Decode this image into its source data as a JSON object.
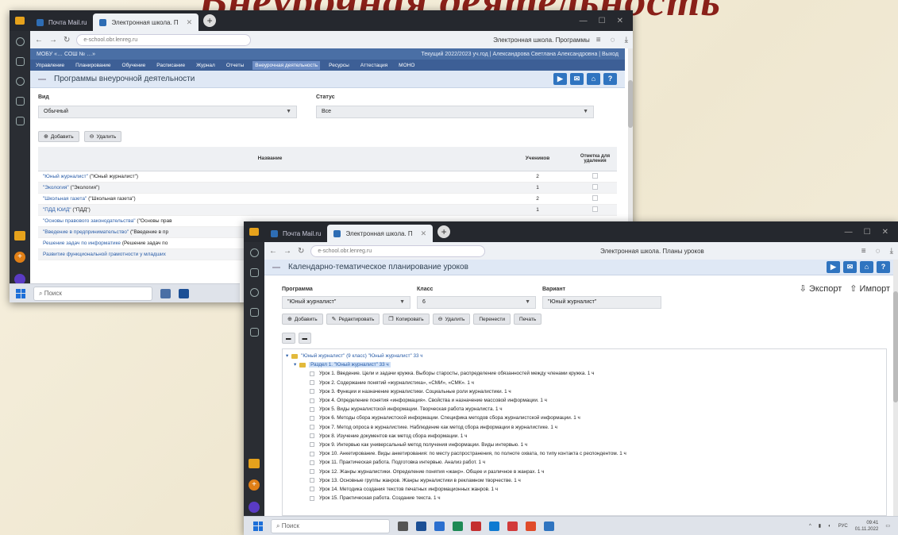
{
  "slide_title": "Внеурочная деятельность",
  "colors": {
    "accent_blue": "#2f74c0",
    "menu_blue": "#3d5f96",
    "title_red": "#8a2019"
  },
  "back": {
    "tabs": [
      {
        "label": "Почта Mail.ru"
      },
      {
        "label": "Электронная школа. П"
      }
    ],
    "url": "e-school.obr.lenreg.ru",
    "page_title": "Электронная школа. Программы",
    "header_left": "МОБУ «… СОШ № …»",
    "header_right": "Текущий 2022/2023 уч.год  |  Александрова Светлана Александровна  |  Выход",
    "menu": [
      "Управление",
      "Планирование",
      "Обучение",
      "Расписание",
      "Журнал",
      "Отчеты",
      "Внеурочная деятельность",
      "Ресурсы",
      "Аттестация",
      "МОНО"
    ],
    "menu_active": "Внеурочная деятельность",
    "page_heading": "Программы внеурочной деятельности",
    "view_label": "Вид",
    "view_value": "Обычный",
    "status_label": "Статус",
    "status_value": "Все",
    "add_button": "Добавить",
    "delete_button": "Удалить",
    "table_headers": {
      "name": "Название",
      "count": "Учеников",
      "mark": "Отметка для удаления"
    },
    "rows": [
      {
        "name": "\"Юный журналист\"",
        "tail": " (\"Юный журналист\")",
        "count": "2"
      },
      {
        "name": "\"Экология\"",
        "tail": " (\"Экология\")",
        "count": "1"
      },
      {
        "name": "\"Школьная газета\"",
        "tail": " (\"Школьная газета\")",
        "count": "2"
      },
      {
        "name": "\"ПДД ЮИД\"",
        "tail": " (\"ПДД\")",
        "count": "1"
      },
      {
        "name": "\"Основы правового законодательства\"",
        "tail": " (\"Основы прав",
        "count": ""
      },
      {
        "name": "\"Введение в предпринимательство\"",
        "tail": " (\"Введение в пр",
        "count": ""
      },
      {
        "name": "Решение задач по информатике",
        "tail": " (Решение задач по",
        "count": ""
      },
      {
        "name": "Развитие функциональной грамотности у младших",
        "tail": "",
        "count": ""
      }
    ],
    "taskbar_search": "Поиск"
  },
  "front": {
    "tabs": [
      {
        "label": "Почта Mail.ru"
      },
      {
        "label": "Электронная школа. П"
      }
    ],
    "url": "e-school.obr.lenreg.ru",
    "page_title": "Электронная школа. Планы уроков",
    "page_heading": "Календарно-тематическое планирование уроков",
    "export_label": "Экспорт",
    "import_label": "Импорт",
    "program_label": "Программа",
    "program_value": "\"Юный журналист\"",
    "class_label": "Класс",
    "class_value": "6",
    "variant_label": "Вариант",
    "variant_value": "\"Юный журналист\"",
    "buttons": [
      "Добавить",
      "Редактировать",
      "Копировать",
      "Удалить",
      "Перенести",
      "Печать"
    ],
    "tree_root": "\"Юный журналист\" (9 класс) \"Юный журналист\" 33 ч",
    "tree_section": "Раздел 1. \"Юный журналист\" 33 ч",
    "lessons": [
      "Урок 1. Введение. Цели и задачи кружка. Выборы старосты, распределение обязанностей между членами кружка. 1 ч",
      "Урок 2. Содержание понятий «журналистика», «СМИ», «СМК». 1 ч",
      "Урок 3. Функции и назначение журналистики. Социальные роли журналистики. 1 ч",
      "Урок 4. Определение понятия «информация». Свойства и назначение массовой информации. 1 ч",
      "Урок 5. Виды журналистской информации. Творческая работа журналиста. 1 ч",
      "Урок 6. Методы сбора журналистской информации. Специфика методов сбора журналистской информации. 1 ч",
      "Урок 7. Метод опроса в журналистике. Наблюдение как метод сбора информации в журналистике. 1 ч",
      "Урок 8. Изучение документов как метод сбора информации. 1 ч",
      "Урок 9. Интервью как универсальный метод получения информации. Виды интервью. 1 ч",
      "Урок 10. Анкетирование. Виды анкетирования: по месту распространения, по полноте охвата, по типу контакта с респондентом. 1 ч",
      "Урок 11. Практическая работа. Подготовка интервью. Анализ работ. 1 ч",
      "Урок 12. Жанры журналистики. Определение понятия «жанр». Общее и различное в жанрах. 1 ч",
      "Урок 13. Основные группы жанров. Жанры журналистики в рекламном творчестве. 1 ч",
      "Урок 14. Методика создания текстов печатных информационных жанров. 1 ч",
      "Урок 15. Практическая работа. Создание текста. 1 ч"
    ],
    "taskbar_search": "Поиск",
    "tray_time": "09:41",
    "tray_date": "01.11.2022"
  }
}
